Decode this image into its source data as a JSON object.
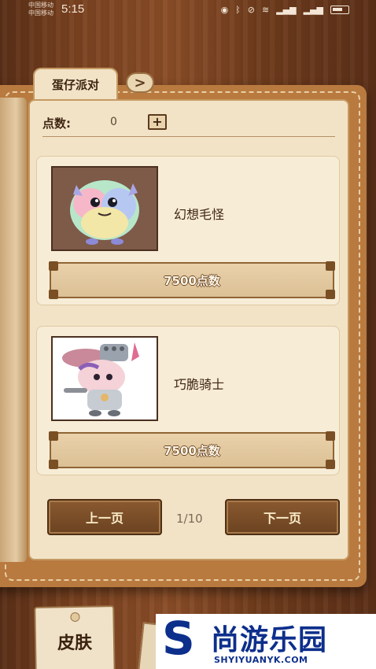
{
  "status_bar": {
    "carrier_1": "中国移动",
    "carrier_2": "中国移动",
    "time": "5:15",
    "icons": [
      "eye-icon",
      "bluetooth-icon",
      "mute-icon",
      "wifi-icon",
      "signal-icon",
      "signal-icon",
      "battery-icon"
    ]
  },
  "header": {
    "tab_title": "蛋仔派对",
    "next_tab_symbol": ">"
  },
  "points": {
    "label": "点数:",
    "value": "0",
    "add_symbol": "+"
  },
  "items": [
    {
      "name": "幻想毛怪",
      "price": "7500点数"
    },
    {
      "name": "巧脆骑士",
      "price": "7500点数"
    }
  ],
  "pagination": {
    "prev_label": "上一页",
    "next_label": "下一页",
    "page_indicator": "1/10"
  },
  "bottom": {
    "skin_tab": "皮肤"
  },
  "watermark": {
    "logo_letter": "S",
    "title": "尚游乐园",
    "url": "SHYIYUANYK.COM"
  },
  "colors": {
    "wood": "#7a4220",
    "paper": "#f2e3c7",
    "button_brown": "#7a4b25",
    "watermark_blue": "#0d2f8c"
  }
}
